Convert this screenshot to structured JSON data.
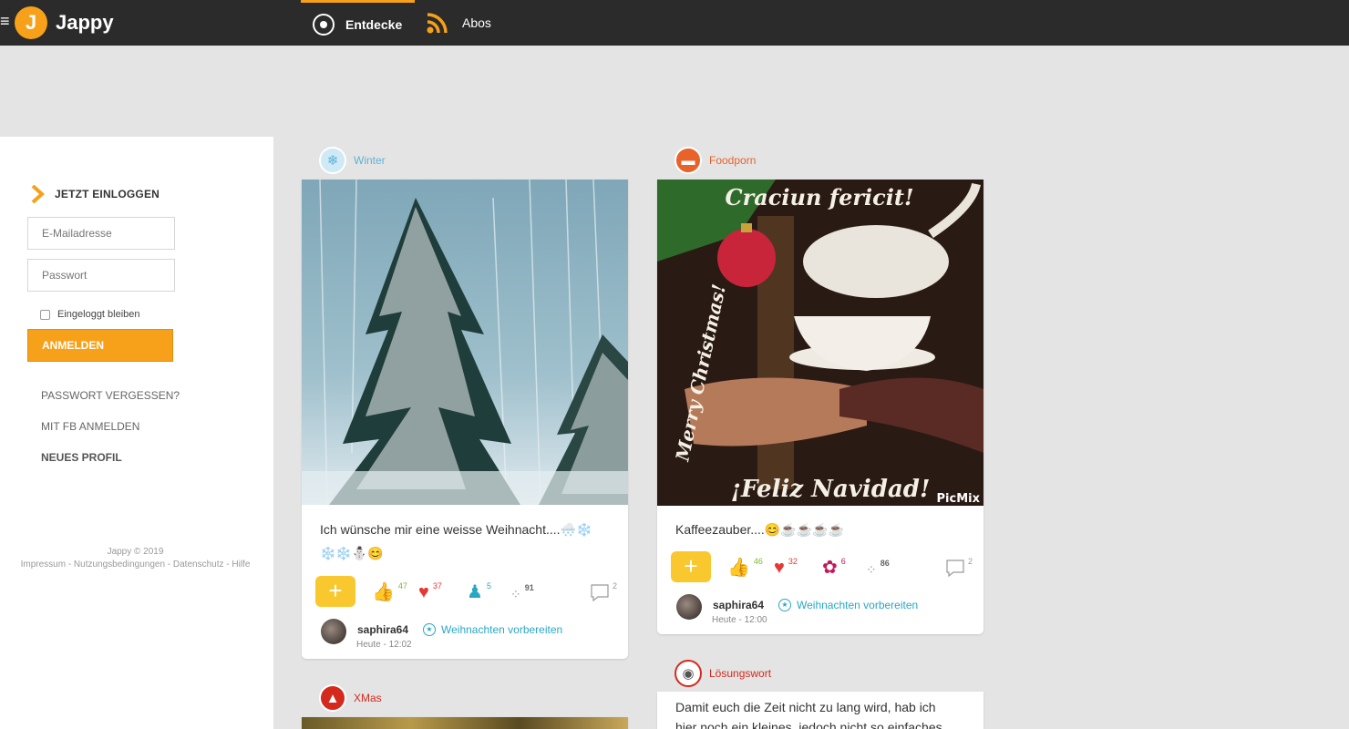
{
  "app": {
    "logo_letter": "J",
    "name": "Jappy",
    "menu_glyph": "≡"
  },
  "nav": {
    "tabs": [
      {
        "label": "Entdecke",
        "icon": "discover-circle-icon",
        "active": true
      },
      {
        "label": "Abos",
        "icon": "rss-icon",
        "active": false
      }
    ]
  },
  "login": {
    "heading": "JETZT EINLOGGEN",
    "email_placeholder": "E-Mailadresse",
    "password_placeholder": "Passwort",
    "remember_label": "Eingeloggt bleiben",
    "submit_label": "ANMELDEN",
    "links": [
      "PASSWORT VERGESSEN?",
      "MIT FB ANMELDEN",
      "NEUES PROFIL"
    ]
  },
  "footer": {
    "copyright": "Jappy © 2019",
    "links": "Impressum - Nutzungsbedingungen - Datenschutz - Hilfe"
  },
  "colors": {
    "accent": "#f7a11a",
    "plus": "#f9c82e",
    "topbar": "#2b2b2b",
    "link_teal": "#2aa7c6"
  },
  "posts": [
    {
      "category": "Winter",
      "category_color": "#5fb3d6",
      "image": "snowy-forest-gif",
      "text_line1": "Ich wünsche mir eine weisse Weihnacht....🌨️❄️",
      "text_line2": "❄️❄️⛄😊",
      "stats": {
        "likes": "47",
        "hearts": "37",
        "persons": "5",
        "views": "91",
        "comments": "2"
      },
      "author": "saphira64",
      "time": "Heute - 12:02",
      "group": "Weihnachten vorbereiten"
    },
    {
      "category": "Foodporn",
      "category_color": "#e8622a",
      "image": "christmas-tea-gif",
      "image_text": {
        "top": "Craciun fericit!",
        "side": "Merry Christmas!",
        "bottom": "¡Feliz Navidad!",
        "watermark": "PicMix"
      },
      "text_line1": "Kaffeezauber....😊☕☕☕☕",
      "stats": {
        "likes": "46",
        "hearts": "32",
        "awards": "6",
        "views": "86",
        "comments": "2"
      },
      "author": "saphira64",
      "time": "Heute - 12:00",
      "group": "Weihnachten vorbereiten"
    },
    {
      "category": "XMas",
      "category_color": "#d42a1e"
    },
    {
      "category": "Lösungswort",
      "category_color": "#d42a1e",
      "text_line1": "Damit euch die Zeit nicht zu lang wird, hab ich",
      "text_line2": "hier noch ein kleines, jedoch nicht so einfaches"
    }
  ]
}
